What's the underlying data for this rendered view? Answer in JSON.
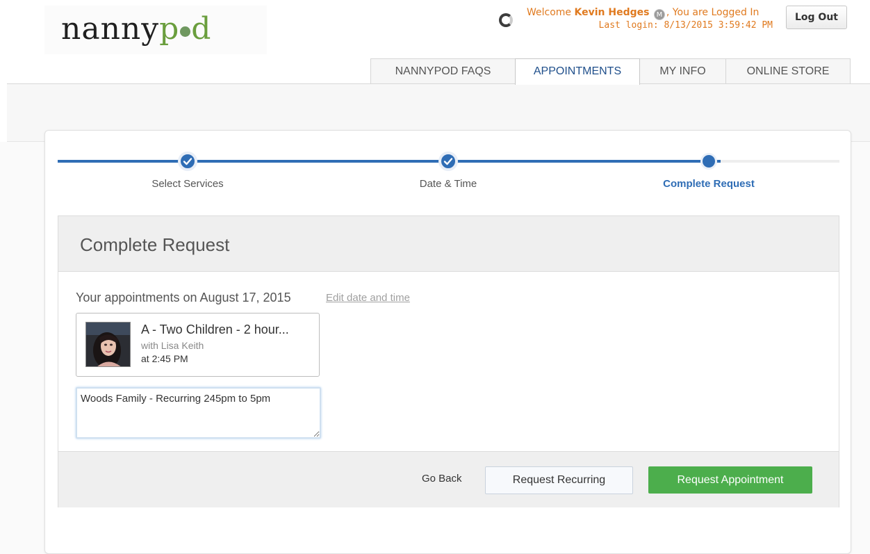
{
  "brand": {
    "logo_part1": "nanny",
    "logo_part2": "p",
    "logo_part3": "d"
  },
  "user": {
    "welcome_prefix": "Welcome",
    "name": "Kevin Hedges",
    "badge_letter": "M",
    "logged_in_text": ", You are Logged In",
    "last_login": "Last login: 8/13/2015 3:59:42 PM",
    "logout_label": "Log Out"
  },
  "nav": {
    "tabs": [
      {
        "label": "NANNYPOD FAQS"
      },
      {
        "label": "APPOINTMENTS"
      },
      {
        "label": "MY INFO"
      },
      {
        "label": "ONLINE STORE"
      }
    ],
    "active_index": 1
  },
  "steps": [
    {
      "label": "Select Services",
      "status": "complete"
    },
    {
      "label": "Date & Time",
      "status": "complete"
    },
    {
      "label": "Complete Request",
      "status": "current"
    }
  ],
  "panel": {
    "title": "Complete Request",
    "appointments_line": "Your appointments on August 17, 2015",
    "edit_link": "Edit date and time",
    "appointment": {
      "title": "A - Two Children - 2 hour...",
      "with": "with Lisa Keith",
      "time": "at 2:45 PM"
    },
    "notes_value": "Woods Family - Recurring 245pm to 5pm"
  },
  "footer": {
    "go_back": "Go Back",
    "request_recurring": "Request Recurring",
    "request_appointment": "Request Appointment"
  },
  "colors": {
    "accent_blue": "#2f6db5",
    "welcome_orange": "#e07a1f",
    "primary_green": "#4cae4c",
    "logo_green": "#6a9e3d"
  }
}
